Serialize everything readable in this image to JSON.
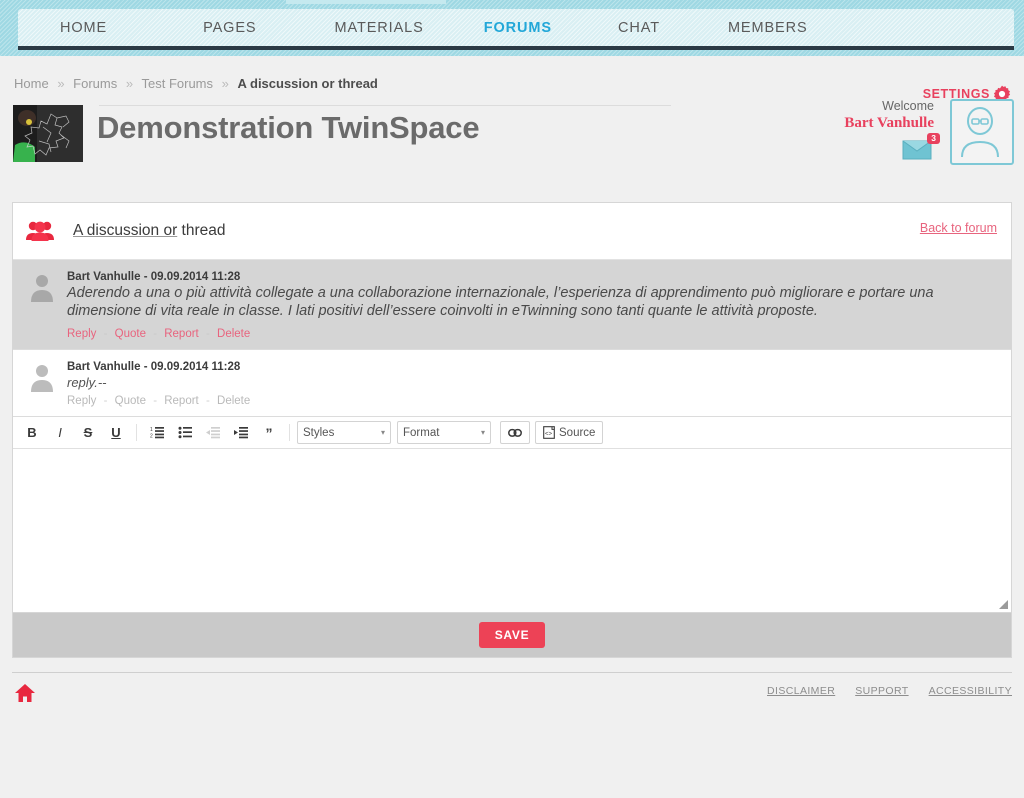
{
  "nav": {
    "items": [
      {
        "label": "HOME",
        "active": false
      },
      {
        "label": "PAGES",
        "active": false
      },
      {
        "label": "MATERIALS",
        "active": false
      },
      {
        "label": "FORUMS",
        "active": true
      },
      {
        "label": "CHAT",
        "active": false
      },
      {
        "label": "MEMBERS",
        "active": false
      }
    ]
  },
  "breadcrumb": {
    "items": [
      "Home",
      "Forums",
      "Test Forums"
    ],
    "separator": "»",
    "current": "A discussion or thread"
  },
  "settings": {
    "label": "SETTINGS",
    "icon": "gear-icon",
    "color": "#e8415e"
  },
  "header": {
    "title": "Demonstration TwinSpace",
    "welcome_label": "Welcome",
    "user_name": "Bart Vanhulle",
    "message_count": "3",
    "message_icon": "envelope-icon",
    "avatar_icon": "user-avatar-icon"
  },
  "thread": {
    "icon": "group-users-icon",
    "title_underlined": "A discussion or",
    "title_rest": " thread",
    "back_link": "Back to forum"
  },
  "posts": [
    {
      "author": "Bart Vanhulle",
      "separator": "-",
      "timestamp": "09.09.2014 11:28",
      "body": "Aderendo a una o più attività collegate a una collaborazione internazionale, l’esperienza di apprendimento può migliorare e portare una dimensione di vita reale in classe. I lati positivi dell’essere coinvolti in eTwinning sono tanti quante le attività proposte.",
      "actions": [
        "Reply",
        "Quote",
        "Report",
        "Delete"
      ]
    },
    {
      "author": "Bart Vanhulle",
      "separator": "-",
      "timestamp": "09.09.2014 11:28",
      "body": "reply.--",
      "actions": [
        "Reply",
        "Quote",
        "Report",
        "Delete"
      ]
    }
  ],
  "editor": {
    "toolbar": {
      "bold": "B",
      "italic": "I",
      "strike": "S",
      "underline": "U",
      "numbered_list": "numbered-list-icon",
      "bulleted_list": "bulleted-list-icon",
      "outdent": "outdent-icon",
      "indent": "indent-icon",
      "blockquote": "”",
      "styles_label": "Styles",
      "format_label": "Format",
      "link_icon": "link-chain-icon",
      "source_label": "Source",
      "source_icon": "source-page-icon",
      "caret": "▾"
    },
    "content": "",
    "placeholder": ""
  },
  "save": {
    "label": "SAVE",
    "color": "#ed4256"
  },
  "footer": {
    "home_icon": "home-icon",
    "links": [
      "DISCLAIMER",
      "SUPPORT",
      "ACCESSIBILITY"
    ]
  }
}
